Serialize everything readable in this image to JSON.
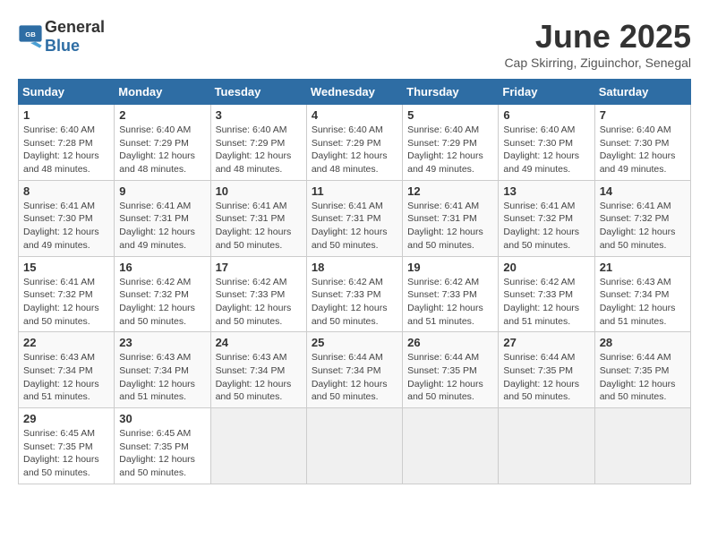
{
  "logo": {
    "text_general": "General",
    "text_blue": "Blue"
  },
  "header": {
    "month_year": "June 2025",
    "location": "Cap Skirring, Ziguinchor, Senegal"
  },
  "calendar": {
    "days_of_week": [
      "Sunday",
      "Monday",
      "Tuesday",
      "Wednesday",
      "Thursday",
      "Friday",
      "Saturday"
    ],
    "weeks": [
      [
        null,
        null,
        null,
        null,
        null,
        null,
        null
      ]
    ],
    "cells": [
      {
        "day": null,
        "info": null
      },
      {
        "day": null,
        "info": null
      },
      {
        "day": null,
        "info": null
      },
      {
        "day": null,
        "info": null
      },
      {
        "day": null,
        "info": null
      },
      {
        "day": null,
        "info": null
      },
      {
        "day": null,
        "info": null
      }
    ],
    "rows": [
      [
        {
          "day": "1",
          "sunrise": "6:40 AM",
          "sunset": "7:28 PM",
          "daylight": "12 hours and 48 minutes."
        },
        {
          "day": "2",
          "sunrise": "6:40 AM",
          "sunset": "7:29 PM",
          "daylight": "12 hours and 48 minutes."
        },
        {
          "day": "3",
          "sunrise": "6:40 AM",
          "sunset": "7:29 PM",
          "daylight": "12 hours and 48 minutes."
        },
        {
          "day": "4",
          "sunrise": "6:40 AM",
          "sunset": "7:29 PM",
          "daylight": "12 hours and 48 minutes."
        },
        {
          "day": "5",
          "sunrise": "6:40 AM",
          "sunset": "7:29 PM",
          "daylight": "12 hours and 49 minutes."
        },
        {
          "day": "6",
          "sunrise": "6:40 AM",
          "sunset": "7:30 PM",
          "daylight": "12 hours and 49 minutes."
        },
        {
          "day": "7",
          "sunrise": "6:40 AM",
          "sunset": "7:30 PM",
          "daylight": "12 hours and 49 minutes."
        }
      ],
      [
        {
          "day": "8",
          "sunrise": "6:41 AM",
          "sunset": "7:30 PM",
          "daylight": "12 hours and 49 minutes."
        },
        {
          "day": "9",
          "sunrise": "6:41 AM",
          "sunset": "7:31 PM",
          "daylight": "12 hours and 49 minutes."
        },
        {
          "day": "10",
          "sunrise": "6:41 AM",
          "sunset": "7:31 PM",
          "daylight": "12 hours and 50 minutes."
        },
        {
          "day": "11",
          "sunrise": "6:41 AM",
          "sunset": "7:31 PM",
          "daylight": "12 hours and 50 minutes."
        },
        {
          "day": "12",
          "sunrise": "6:41 AM",
          "sunset": "7:31 PM",
          "daylight": "12 hours and 50 minutes."
        },
        {
          "day": "13",
          "sunrise": "6:41 AM",
          "sunset": "7:32 PM",
          "daylight": "12 hours and 50 minutes."
        },
        {
          "day": "14",
          "sunrise": "6:41 AM",
          "sunset": "7:32 PM",
          "daylight": "12 hours and 50 minutes."
        }
      ],
      [
        {
          "day": "15",
          "sunrise": "6:41 AM",
          "sunset": "7:32 PM",
          "daylight": "12 hours and 50 minutes."
        },
        {
          "day": "16",
          "sunrise": "6:42 AM",
          "sunset": "7:32 PM",
          "daylight": "12 hours and 50 minutes."
        },
        {
          "day": "17",
          "sunrise": "6:42 AM",
          "sunset": "7:33 PM",
          "daylight": "12 hours and 50 minutes."
        },
        {
          "day": "18",
          "sunrise": "6:42 AM",
          "sunset": "7:33 PM",
          "daylight": "12 hours and 50 minutes."
        },
        {
          "day": "19",
          "sunrise": "6:42 AM",
          "sunset": "7:33 PM",
          "daylight": "12 hours and 51 minutes."
        },
        {
          "day": "20",
          "sunrise": "6:42 AM",
          "sunset": "7:33 PM",
          "daylight": "12 hours and 51 minutes."
        },
        {
          "day": "21",
          "sunrise": "6:43 AM",
          "sunset": "7:34 PM",
          "daylight": "12 hours and 51 minutes."
        }
      ],
      [
        {
          "day": "22",
          "sunrise": "6:43 AM",
          "sunset": "7:34 PM",
          "daylight": "12 hours and 51 minutes."
        },
        {
          "day": "23",
          "sunrise": "6:43 AM",
          "sunset": "7:34 PM",
          "daylight": "12 hours and 51 minutes."
        },
        {
          "day": "24",
          "sunrise": "6:43 AM",
          "sunset": "7:34 PM",
          "daylight": "12 hours and 50 minutes."
        },
        {
          "day": "25",
          "sunrise": "6:44 AM",
          "sunset": "7:34 PM",
          "daylight": "12 hours and 50 minutes."
        },
        {
          "day": "26",
          "sunrise": "6:44 AM",
          "sunset": "7:35 PM",
          "daylight": "12 hours and 50 minutes."
        },
        {
          "day": "27",
          "sunrise": "6:44 AM",
          "sunset": "7:35 PM",
          "daylight": "12 hours and 50 minutes."
        },
        {
          "day": "28",
          "sunrise": "6:44 AM",
          "sunset": "7:35 PM",
          "daylight": "12 hours and 50 minutes."
        }
      ],
      [
        {
          "day": "29",
          "sunrise": "6:45 AM",
          "sunset": "7:35 PM",
          "daylight": "12 hours and 50 minutes."
        },
        {
          "day": "30",
          "sunrise": "6:45 AM",
          "sunset": "7:35 PM",
          "daylight": "12 hours and 50 minutes."
        },
        null,
        null,
        null,
        null,
        null
      ]
    ]
  }
}
